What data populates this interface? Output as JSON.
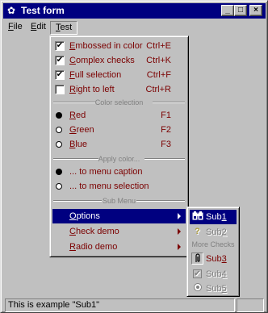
{
  "window": {
    "title": "Test form",
    "controls": [
      "minimize-button",
      "maximize-button",
      "close-button"
    ],
    "control_glyphs": {
      "minimize": "_",
      "maximize": "□",
      "close": "×"
    }
  },
  "menubar": {
    "items": [
      {
        "label": "File",
        "accel_char": "F",
        "rest": "ile"
      },
      {
        "label": "Edit",
        "accel_char": "E",
        "rest": "dit"
      },
      {
        "label": "Test",
        "accel_char": "T",
        "rest": "est"
      }
    ]
  },
  "test_menu": {
    "check_items": [
      {
        "label": "Embossed in color",
        "u": "E",
        "rest": "mbossed in color",
        "shortcut": "Ctrl+E",
        "checked": true
      },
      {
        "label": "Complex checks",
        "u": "C",
        "rest": "omplex checks",
        "shortcut": "Ctrl+K",
        "checked": true
      },
      {
        "label": "Full selection",
        "u": "F",
        "rest": "ull selection",
        "shortcut": "Ctrl+F",
        "checked": true
      },
      {
        "label": "Right to left",
        "u": "R",
        "rest": "ight to left",
        "shortcut": "Ctrl+R",
        "checked": false
      }
    ],
    "color_separator": "Color selection",
    "colors": [
      {
        "label": "Red",
        "u": "R",
        "rest": "ed",
        "shortcut": "F1",
        "selected": true
      },
      {
        "label": "Green",
        "u": "G",
        "rest": "reen",
        "shortcut": "F2",
        "selected": false
      },
      {
        "label": "Blue",
        "u": "B",
        "rest": "lue",
        "shortcut": "F3",
        "selected": false
      }
    ],
    "apply_separator": "Apply color...",
    "apply": [
      {
        "label": "... to menu caption",
        "selected": true
      },
      {
        "label": "... to menu selection",
        "selected": false
      }
    ],
    "submenu_separator": "Sub Menu",
    "submenus": [
      {
        "label": "Options",
        "u": "O",
        "rest": "ptions",
        "highlighted": true
      },
      {
        "label": "Check demo",
        "u": "C",
        "rest": "heck demo",
        "highlighted": false
      },
      {
        "label": "Radio demo",
        "u": "R",
        "rest": "adio demo",
        "highlighted": false
      }
    ]
  },
  "options_submenu": {
    "items": [
      {
        "label": "Sub1",
        "prefix": "Sub",
        "u": "1",
        "icon": "binoculars-icon",
        "state": "highlighted"
      },
      {
        "label": "Sub2",
        "prefix": "Sub",
        "u": "2",
        "icon": "question-icon",
        "state": "disabled"
      },
      {
        "separator": "More Checks"
      },
      {
        "label": "Sub3",
        "prefix": "Sub",
        "u": "3",
        "icon": "paperclip-icon",
        "state": "normal"
      },
      {
        "label": "Sub4",
        "prefix": "Sub",
        "u": "4",
        "icon": "checkbox-icon",
        "state": "disabled"
      },
      {
        "label": "Sub5",
        "prefix": "Sub",
        "u": "5",
        "icon": "radio-icon",
        "state": "disabled"
      }
    ]
  },
  "status": {
    "text": "This is example \"Sub1\""
  },
  "colors": {
    "titlebar": "#000080",
    "menu_text": "#7b0000",
    "highlight": "#000080",
    "face": "#c0c0c0"
  }
}
